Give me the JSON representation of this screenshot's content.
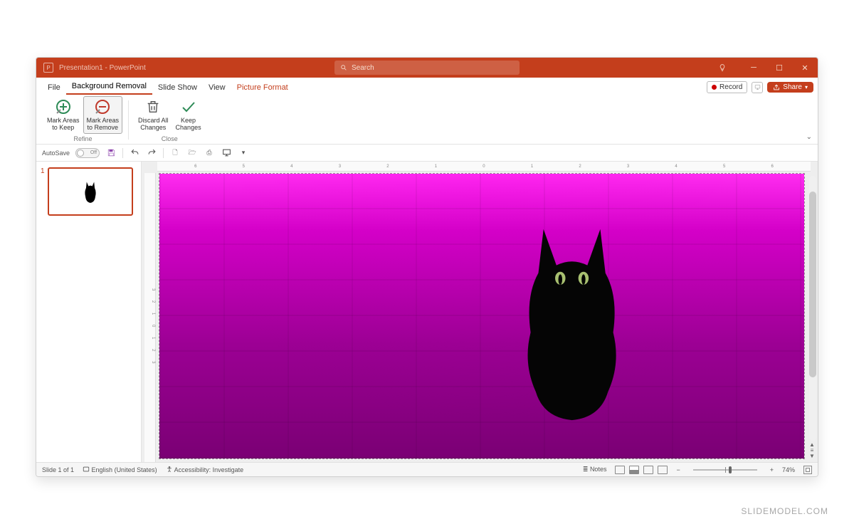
{
  "titlebar": {
    "document_name": "Presentation1",
    "app_name": "PowerPoint",
    "title_text": "Presentation1  -  PowerPoint",
    "search_placeholder": "Search"
  },
  "menu": {
    "tabs": [
      "File",
      "Background Removal",
      "Slide Show",
      "View",
      "Picture Format"
    ],
    "active_tab": "Background Removal",
    "accent_tab": "Picture Format",
    "record_label": "Record",
    "share_label": "Share"
  },
  "ribbon": {
    "groups": [
      {
        "label": "Refine",
        "buttons": [
          {
            "id": "mark-keep",
            "line1": "Mark Areas",
            "line2": "to Keep",
            "icon": "plus-circle",
            "color": "#2e8b57",
            "selected": false
          },
          {
            "id": "mark-remove",
            "line1": "Mark Areas",
            "line2": "to Remove",
            "icon": "minus-circle",
            "color": "#c0392b",
            "selected": true
          }
        ]
      },
      {
        "label": "Close",
        "buttons": [
          {
            "id": "discard",
            "line1": "Discard All",
            "line2": "Changes",
            "icon": "trash",
            "color": "#555",
            "selected": false
          },
          {
            "id": "keep",
            "line1": "Keep",
            "line2": "Changes",
            "icon": "check",
            "color": "#2e8b57",
            "selected": false
          }
        ]
      }
    ]
  },
  "qat": {
    "autosave_label": "AutoSave",
    "autosave_state": "Off"
  },
  "ruler": {
    "h_marks": [
      "6",
      "5",
      "4",
      "3",
      "2",
      "1",
      "0",
      "1",
      "2",
      "3",
      "4",
      "5",
      "6"
    ],
    "v_marks": [
      "3",
      "2",
      "1",
      "0",
      "1",
      "2",
      "3"
    ]
  },
  "thumbs": {
    "slides": [
      {
        "number": "1"
      }
    ]
  },
  "statusbar": {
    "slide_pos": "Slide 1 of 1",
    "language": "English (United States)",
    "accessibility": "Accessibility: Investigate",
    "notes_label": "Notes",
    "zoom_pct": "74%"
  },
  "watermark": "SLIDEMODEL.COM"
}
